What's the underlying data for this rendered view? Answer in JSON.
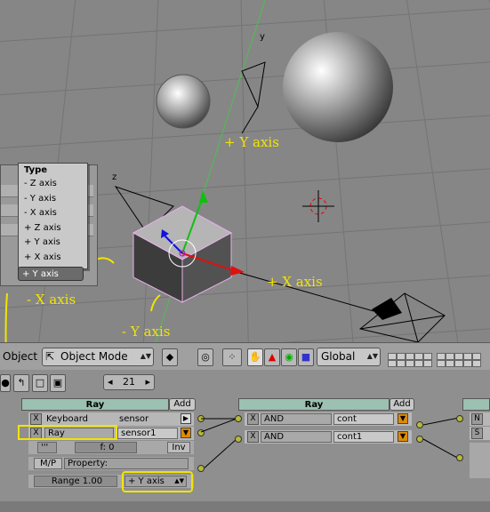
{
  "viewport": {
    "axis_labels": {
      "y": "y",
      "z": "z"
    },
    "annotations": {
      "plus_y": "+ Y axis",
      "plus_x": "+ X axis",
      "minus_x": "- X axis",
      "minus_y": "- Y axis"
    },
    "type_popup": {
      "title": "Type",
      "options": [
        "- Z axis",
        "- Y axis",
        "- X axis",
        "+ Z axis",
        "+ Y axis",
        "+ X axis"
      ]
    },
    "axis_select_value": "+ Y axis"
  },
  "header": {
    "menu_object": "Object",
    "mode": "Object Mode",
    "orientation": "Global"
  },
  "logic": {
    "frame_number": "21",
    "sensor_panel": {
      "title": "Ray",
      "add_label": "Add"
    },
    "controller_panel": {
      "title": "Ray",
      "add_label": "Add"
    },
    "sensors": [
      {
        "x": "X",
        "type": "Keyboard",
        "name": "sensor"
      },
      {
        "x": "X",
        "type": "Ray",
        "name": "sensor1"
      }
    ],
    "ray_options": {
      "freq": "f: 0",
      "inv": "Inv",
      "mp": "M/P",
      "property": "Property:",
      "range": "Range 1.00",
      "axis": "+ Y axis"
    },
    "controllers": [
      {
        "x": "X",
        "type": "AND",
        "name": "cont"
      },
      {
        "x": "X",
        "type": "AND",
        "name": "cont1"
      }
    ],
    "actuator_stub": [
      "N",
      "S"
    ]
  },
  "colors": {
    "annotation": "#f2e400",
    "panel_header": "#9cc0b2",
    "red_axis": "#e01010",
    "green_axis": "#10c010",
    "blue_axis": "#1010e0"
  }
}
